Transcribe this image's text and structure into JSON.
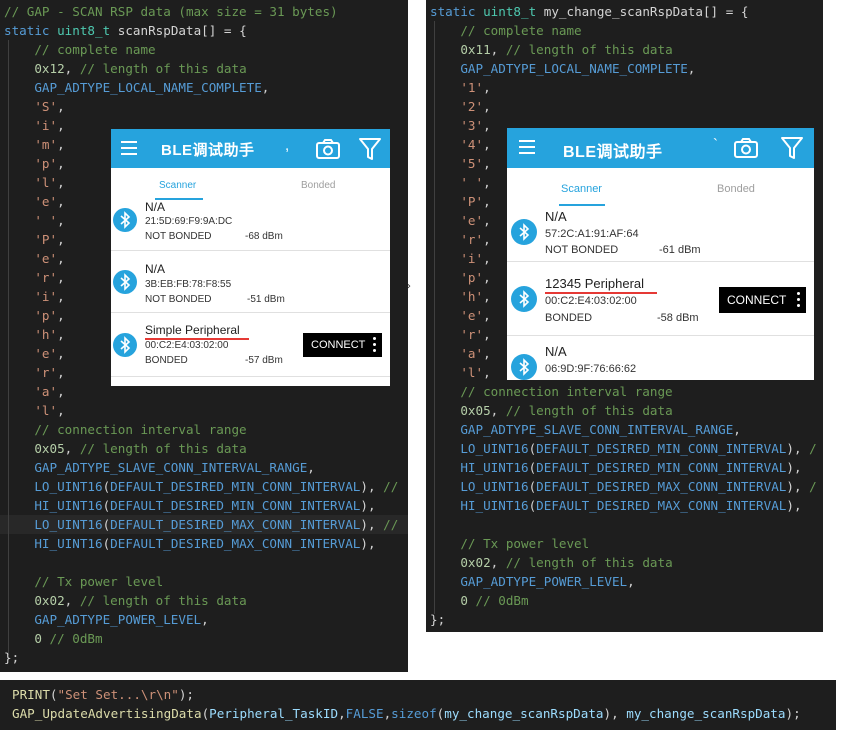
{
  "left_code": {
    "lines": [
      [
        [
          "c-comment",
          "// GAP - SCAN RSP data (max size = 31 bytes)"
        ]
      ],
      [
        [
          "c-keyword",
          "static "
        ],
        [
          "c-type",
          "uint8_t "
        ],
        [
          "c-plain",
          "scanRspData[] = {"
        ]
      ],
      [
        [
          "c-comment",
          "    // complete name"
        ]
      ],
      [
        [
          "c-number",
          "    0x12"
        ],
        [
          "c-plain",
          ", "
        ],
        [
          "c-comment",
          "// length of this data"
        ]
      ],
      [
        [
          "c-macro",
          "    GAP_ADTYPE_LOCAL_NAME_COMPLETE"
        ],
        [
          "c-plain",
          ","
        ]
      ],
      [
        [
          "c-string",
          "    'S'"
        ],
        [
          "c-plain",
          ","
        ]
      ],
      [
        [
          "c-string",
          "    'i'"
        ],
        [
          "c-plain",
          ","
        ]
      ],
      [
        [
          "c-string",
          "    'm'"
        ],
        [
          "c-plain",
          ","
        ]
      ],
      [
        [
          "c-string",
          "    'p'"
        ],
        [
          "c-plain",
          ","
        ]
      ],
      [
        [
          "c-string",
          "    'l'"
        ],
        [
          "c-plain",
          ","
        ]
      ],
      [
        [
          "c-string",
          "    'e'"
        ],
        [
          "c-plain",
          ","
        ]
      ],
      [
        [
          "c-string",
          "    ' '"
        ],
        [
          "c-plain",
          ","
        ]
      ],
      [
        [
          "c-string",
          "    'P'"
        ],
        [
          "c-plain",
          ","
        ]
      ],
      [
        [
          "c-string",
          "    'e'"
        ],
        [
          "c-plain",
          ","
        ]
      ],
      [
        [
          "c-string",
          "    'r'"
        ],
        [
          "c-plain",
          ","
        ]
      ],
      [
        [
          "c-string",
          "    'i'"
        ],
        [
          "c-plain",
          ","
        ]
      ],
      [
        [
          "c-string",
          "    'p'"
        ],
        [
          "c-plain",
          ","
        ]
      ],
      [
        [
          "c-string",
          "    'h'"
        ],
        [
          "c-plain",
          ","
        ]
      ],
      [
        [
          "c-string",
          "    'e'"
        ],
        [
          "c-plain",
          ","
        ]
      ],
      [
        [
          "c-string",
          "    'r'"
        ],
        [
          "c-plain",
          ","
        ]
      ],
      [
        [
          "c-string",
          "    'a'"
        ],
        [
          "c-plain",
          ","
        ]
      ],
      [
        [
          "c-string",
          "    'l'"
        ],
        [
          "c-plain",
          ","
        ]
      ],
      [
        [
          "c-comment",
          "    // connection interval range"
        ]
      ],
      [
        [
          "c-number",
          "    0x05"
        ],
        [
          "c-plain",
          ", "
        ],
        [
          "c-comment",
          "// length of this data"
        ]
      ],
      [
        [
          "c-macro",
          "    GAP_ADTYPE_SLAVE_CONN_INTERVAL_RANGE"
        ],
        [
          "c-plain",
          ","
        ]
      ],
      [
        [
          "c-macro",
          "    LO_UINT16"
        ],
        [
          "c-plain",
          "("
        ],
        [
          "c-macro",
          "DEFAULT_DESIRED_MIN_CONN_INTERVAL"
        ],
        [
          "c-plain",
          "), "
        ],
        [
          "c-comment",
          "//"
        ]
      ],
      [
        [
          "c-macro",
          "    HI_UINT16"
        ],
        [
          "c-plain",
          "("
        ],
        [
          "c-macro",
          "DEFAULT_DESIRED_MIN_CONN_INTERVAL"
        ],
        [
          "c-plain",
          "),"
        ]
      ],
      [
        [
          "c-macro",
          "    LO_UINT16"
        ],
        [
          "c-plain",
          "("
        ],
        [
          "c-macro",
          "DEFAULT_DESIRED_MAX_CONN_INTERVAL"
        ],
        [
          "c-plain",
          "), "
        ],
        [
          "c-comment",
          "//"
        ]
      ],
      [
        [
          "c-macro",
          "    HI_UINT16"
        ],
        [
          "c-plain",
          "("
        ],
        [
          "c-macro",
          "DEFAULT_DESIRED_MAX_CONN_INTERVAL"
        ],
        [
          "c-plain",
          "),"
        ]
      ],
      [
        [
          "c-plain",
          ""
        ]
      ],
      [
        [
          "c-comment",
          "    // Tx power level"
        ]
      ],
      [
        [
          "c-number",
          "    0x02"
        ],
        [
          "c-plain",
          ", "
        ],
        [
          "c-comment",
          "// length of this data"
        ]
      ],
      [
        [
          "c-macro",
          "    GAP_ADTYPE_POWER_LEVEL"
        ],
        [
          "c-plain",
          ","
        ]
      ],
      [
        [
          "c-number",
          "    0 "
        ],
        [
          "c-comment",
          "// 0dBm"
        ]
      ],
      [
        [
          "c-plain",
          "};"
        ]
      ]
    ]
  },
  "right_code": {
    "lines": [
      [
        [
          "c-keyword",
          "static "
        ],
        [
          "c-type",
          "uint8_t "
        ],
        [
          "c-plain",
          "my_change_scanRspData[] = {"
        ]
      ],
      [
        [
          "c-comment",
          "    // complete name"
        ]
      ],
      [
        [
          "c-number",
          "    0x11"
        ],
        [
          "c-plain",
          ", "
        ],
        [
          "c-comment",
          "// length of this data"
        ]
      ],
      [
        [
          "c-macro",
          "    GAP_ADTYPE_LOCAL_NAME_COMPLETE"
        ],
        [
          "c-plain",
          ","
        ]
      ],
      [
        [
          "c-string",
          "    '1'"
        ],
        [
          "c-plain",
          ","
        ]
      ],
      [
        [
          "c-string",
          "    '2'"
        ],
        [
          "c-plain",
          ","
        ]
      ],
      [
        [
          "c-string",
          "    '3'"
        ],
        [
          "c-plain",
          ","
        ]
      ],
      [
        [
          "c-string",
          "    '4'"
        ],
        [
          "c-plain",
          ","
        ]
      ],
      [
        [
          "c-string",
          "    '5'"
        ],
        [
          "c-plain",
          ","
        ]
      ],
      [
        [
          "c-string",
          "    ' '"
        ],
        [
          "c-plain",
          ","
        ]
      ],
      [
        [
          "c-string",
          "    'P'"
        ],
        [
          "c-plain",
          ","
        ]
      ],
      [
        [
          "c-string",
          "    'e'"
        ],
        [
          "c-plain",
          ","
        ]
      ],
      [
        [
          "c-string",
          "    'r'"
        ],
        [
          "c-plain",
          ","
        ]
      ],
      [
        [
          "c-string",
          "    'i'"
        ],
        [
          "c-plain",
          ","
        ]
      ],
      [
        [
          "c-string",
          "    'p'"
        ],
        [
          "c-plain",
          ","
        ]
      ],
      [
        [
          "c-string",
          "    'h'"
        ],
        [
          "c-plain",
          ","
        ]
      ],
      [
        [
          "c-string",
          "    'e'"
        ],
        [
          "c-plain",
          ","
        ]
      ],
      [
        [
          "c-string",
          "    'r'"
        ],
        [
          "c-plain",
          ","
        ]
      ],
      [
        [
          "c-string",
          "    'a'"
        ],
        [
          "c-plain",
          ","
        ]
      ],
      [
        [
          "c-string",
          "    'l'"
        ],
        [
          "c-plain",
          ","
        ]
      ],
      [
        [
          "c-comment",
          "    // connection interval range"
        ]
      ],
      [
        [
          "c-number",
          "    0x05"
        ],
        [
          "c-plain",
          ", "
        ],
        [
          "c-comment",
          "// length of this data"
        ]
      ],
      [
        [
          "c-macro",
          "    GAP_ADTYPE_SLAVE_CONN_INTERVAL_RANGE"
        ],
        [
          "c-plain",
          ","
        ]
      ],
      [
        [
          "c-macro",
          "    LO_UINT16"
        ],
        [
          "c-plain",
          "("
        ],
        [
          "c-macro",
          "DEFAULT_DESIRED_MIN_CONN_INTERVAL"
        ],
        [
          "c-plain",
          "), "
        ],
        [
          "c-comment",
          "/"
        ]
      ],
      [
        [
          "c-macro",
          "    HI_UINT16"
        ],
        [
          "c-plain",
          "("
        ],
        [
          "c-macro",
          "DEFAULT_DESIRED_MIN_CONN_INTERVAL"
        ],
        [
          "c-plain",
          "),"
        ]
      ],
      [
        [
          "c-macro",
          "    LO_UINT16"
        ],
        [
          "c-plain",
          "("
        ],
        [
          "c-macro",
          "DEFAULT_DESIRED_MAX_CONN_INTERVAL"
        ],
        [
          "c-plain",
          "), "
        ],
        [
          "c-comment",
          "/"
        ]
      ],
      [
        [
          "c-macro",
          "    HI_UINT16"
        ],
        [
          "c-plain",
          "("
        ],
        [
          "c-macro",
          "DEFAULT_DESIRED_MAX_CONN_INTERVAL"
        ],
        [
          "c-plain",
          "),"
        ]
      ],
      [
        [
          "c-plain",
          ""
        ]
      ],
      [
        [
          "c-comment",
          "    // Tx power level"
        ]
      ],
      [
        [
          "c-number",
          "    0x02"
        ],
        [
          "c-plain",
          ", "
        ],
        [
          "c-comment",
          "// length of this data"
        ]
      ],
      [
        [
          "c-macro",
          "    GAP_ADTYPE_POWER_LEVEL"
        ],
        [
          "c-plain",
          ","
        ]
      ],
      [
        [
          "c-number",
          "    0 "
        ],
        [
          "c-comment",
          "// 0dBm"
        ]
      ],
      [
        [
          "c-plain",
          "};"
        ]
      ]
    ]
  },
  "bottom_code": {
    "lines": [
      [
        [
          "c-func",
          "PRINT"
        ],
        [
          "c-plain",
          "("
        ],
        [
          "c-string",
          "\"Set Set...\\r\\n\""
        ],
        [
          "c-plain",
          ");"
        ]
      ],
      [
        [
          "c-func",
          "GAP_UpdateAdvertisingData"
        ],
        [
          "c-plain",
          "("
        ],
        [
          "c-ident",
          "Peripheral_TaskID"
        ],
        [
          "c-plain",
          ","
        ],
        [
          "c-macro",
          "FALSE"
        ],
        [
          "c-plain",
          ","
        ],
        [
          "c-keyword",
          "sizeof"
        ],
        [
          "c-plain",
          "("
        ],
        [
          "c-ident",
          "my_change_scanRspData"
        ],
        [
          "c-plain",
          "), "
        ],
        [
          "c-ident",
          "my_change_scanRspData"
        ],
        [
          "c-plain",
          ");"
        ]
      ]
    ]
  },
  "app": {
    "title": "BLE调试助手",
    "tab_scanner": "Scanner",
    "tab_bonded": "Bonded",
    "connect_label": "CONNECT",
    "accent_color": "#26a3dd",
    "icons": [
      "menu-icon",
      "camera-icon",
      "filter-icon",
      "bluetooth-icon",
      "more-vert-icon"
    ]
  },
  "phone_left": {
    "tick": ",",
    "devices": [
      {
        "name": "N/A",
        "mac": "21:5D:69:F9:9A:DC",
        "bond": "NOT BONDED",
        "rssi": "-68 dBm"
      },
      {
        "name": "N/A",
        "mac": "3B:EB:FB:78:F8:55",
        "bond": "NOT BONDED",
        "rssi": "-51 dBm"
      },
      {
        "name": "Simple Peripheral",
        "mac": "00:C2:E4:03:02:00",
        "bond": "BONDED",
        "rssi": "-57 dBm"
      }
    ]
  },
  "phone_right": {
    "tick": "`",
    "devices": [
      {
        "name": "N/A",
        "mac": "57:2C:A1:91:AF:64",
        "bond": "NOT BONDED",
        "rssi": "-61 dBm"
      },
      {
        "name": "12345 Peripheral",
        "mac": "00:C2:E4:03:02:00",
        "bond": "BONDED",
        "rssi": "-58 dBm"
      },
      {
        "name": "N/A",
        "mac": "06:9D:9F:76:66:62"
      }
    ]
  }
}
